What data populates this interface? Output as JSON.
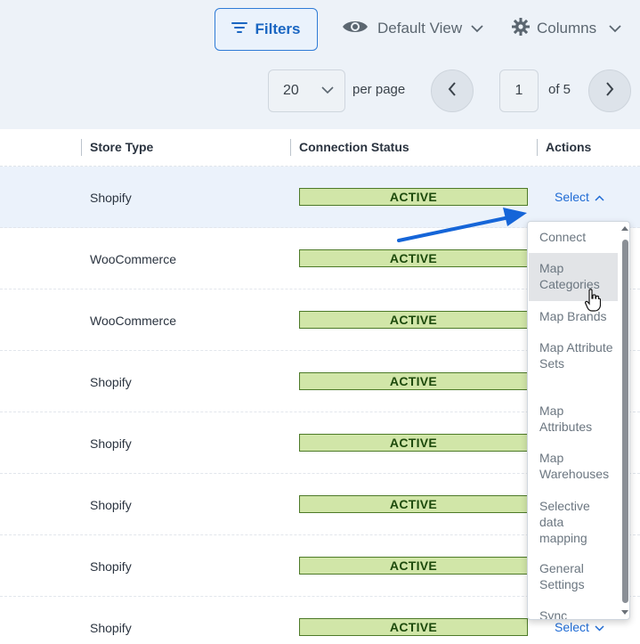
{
  "toolbar": {
    "filters_label": "Filters",
    "view_label": "Default View",
    "columns_label": "Columns"
  },
  "pagination": {
    "per_page_value": "20",
    "per_page_label": "per page",
    "current_page": "1",
    "of_label": "of 5"
  },
  "table": {
    "columns": [
      "Store Type",
      "Connection Status",
      "Actions"
    ],
    "rows": [
      {
        "store_type": "Shopify",
        "status": "ACTIVE",
        "action": "Select"
      },
      {
        "store_type": "WooCommerce",
        "status": "ACTIVE",
        "action": ""
      },
      {
        "store_type": "WooCommerce",
        "status": "ACTIVE",
        "action": ""
      },
      {
        "store_type": "Shopify",
        "status": "ACTIVE",
        "action": ""
      },
      {
        "store_type": "Shopify",
        "status": "ACTIVE",
        "action": ""
      },
      {
        "store_type": "Shopify",
        "status": "ACTIVE",
        "action": ""
      },
      {
        "store_type": "Shopify",
        "status": "ACTIVE",
        "action": ""
      },
      {
        "store_type": "Shopify",
        "status": "ACTIVE",
        "action": "Select"
      }
    ]
  },
  "dropdown": {
    "items": [
      "Connect",
      "Map Categories",
      "Map Brands",
      "Map Attribute Sets",
      "Map Attributes",
      "Map Warehouses",
      "Selective data mapping",
      "General Settings",
      "Sync"
    ]
  },
  "colors": {
    "accent": "#1f6bd4",
    "badge_bg": "#d1e6a8",
    "badge_border": "#4d7a28",
    "annotation_arrow": "#1565d8"
  },
  "icons": {
    "filters": "filter-lines-icon",
    "view": "eye-icon",
    "columns": "gear-icon",
    "prev": "chevron-left-icon",
    "next": "chevron-right-icon"
  }
}
